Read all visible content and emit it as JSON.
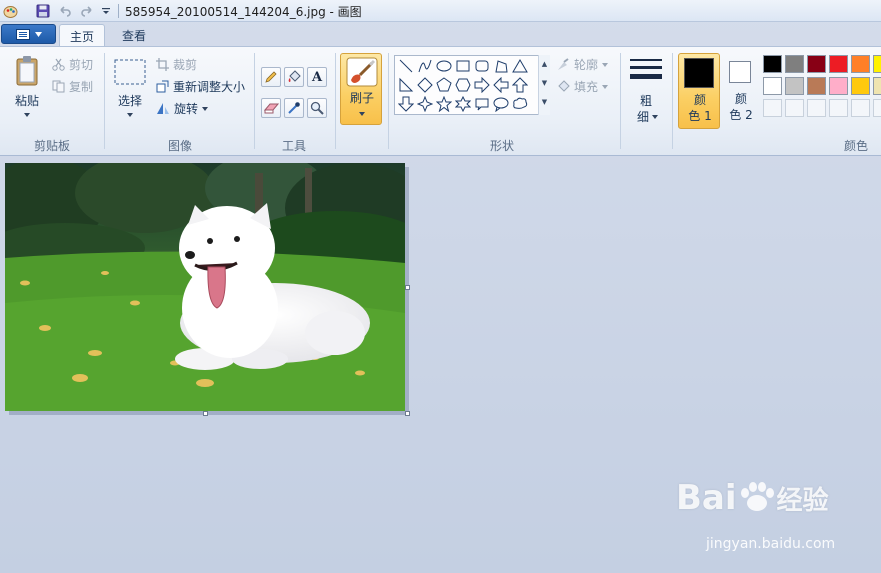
{
  "window": {
    "title": "585954_20100514_144204_6.jpg - 画图"
  },
  "quick_access": {
    "icons": [
      "paint-app-icon",
      "save-icon",
      "undo-icon",
      "redo-icon",
      "customize-dropdown-icon"
    ]
  },
  "tabs": [
    {
      "label": "主页",
      "active": true
    },
    {
      "label": "查看",
      "active": false
    }
  ],
  "ribbon": {
    "clipboard": {
      "paste": "粘贴",
      "cut": "剪切",
      "copy": "复制",
      "label": "剪贴板"
    },
    "image": {
      "select": "选择",
      "crop": "裁剪",
      "resize": "重新调整大小",
      "rotate": "旋转",
      "label": "图像"
    },
    "tools": {
      "label": "工具",
      "items": [
        "pencil-icon",
        "fill-bucket-icon",
        "text-icon",
        "eraser-icon",
        "color-picker-icon",
        "magnifier-icon"
      ]
    },
    "brush": {
      "label": "刷子"
    },
    "shapes": {
      "outline": "轮廓",
      "fill": "填充",
      "label": "形状"
    },
    "size": {
      "label_line1": "粗",
      "label_line2": "细"
    },
    "colors": {
      "color1_line1": "颜",
      "color1_line2": "色 1",
      "color2_line1": "颜",
      "color2_line2": "色 2",
      "label": "颜色",
      "color1_value": "#000000",
      "color2_value": "#ffffff",
      "row1": [
        "#000000",
        "#7f7f7f",
        "#880015",
        "#ed1c24",
        "#ff7f27",
        "#fff200"
      ],
      "row2": [
        "#ffffff",
        "#c3c3c3",
        "#b97a57",
        "#ffaec9",
        "#ffc90e",
        "#efe4b0"
      ]
    }
  },
  "watermark": {
    "brand": "Bai",
    "brand_suffix": "经验",
    "url": "jingyan.baidu.com"
  }
}
